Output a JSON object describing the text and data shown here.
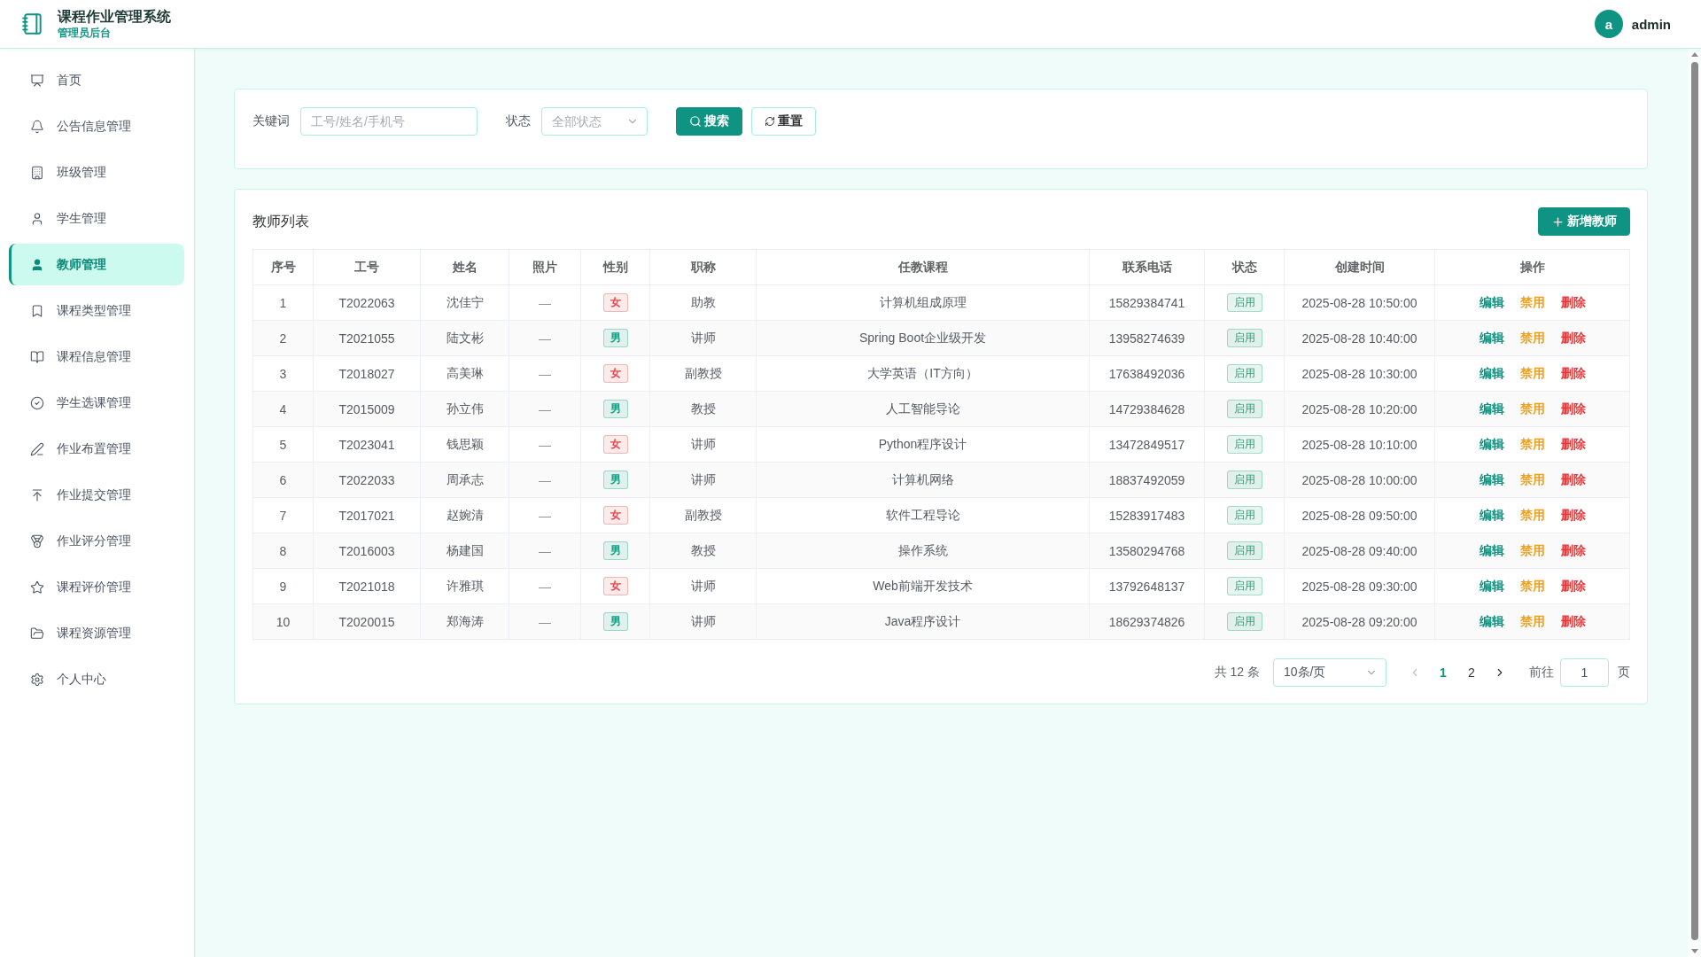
{
  "header": {
    "title": "课程作业管理系统",
    "subtitle": "管理员后台",
    "user": {
      "avatar": "a",
      "name": "admin"
    }
  },
  "sidebar": {
    "items": [
      {
        "label": "首页",
        "selected": false
      },
      {
        "label": "公告信息管理",
        "selected": false
      },
      {
        "label": "班级管理",
        "selected": false
      },
      {
        "label": "学生管理",
        "selected": false
      },
      {
        "label": "教师管理",
        "selected": true
      },
      {
        "label": "课程类型管理",
        "selected": false
      },
      {
        "label": "课程信息管理",
        "selected": false
      },
      {
        "label": "学生选课管理",
        "selected": false
      },
      {
        "label": "作业布置管理",
        "selected": false
      },
      {
        "label": "作业提交管理",
        "selected": false
      },
      {
        "label": "作业评分管理",
        "selected": false
      },
      {
        "label": "课程评价管理",
        "selected": false
      },
      {
        "label": "课程资源管理",
        "selected": false
      },
      {
        "label": "个人中心",
        "selected": false
      }
    ]
  },
  "search": {
    "keyword": {
      "label": "关键词",
      "placeholder": "工号/姓名/手机号"
    },
    "status": {
      "label": "状态",
      "placeholder": "全部状态"
    },
    "buttons": [
      {
        "label": "搜索",
        "kind": "primary"
      },
      {
        "label": "重置",
        "kind": "plain"
      }
    ]
  },
  "teacher_list": {
    "title": "教师列表",
    "add_button": "新增教师",
    "table": {
      "columns": [
        "序号",
        "工号",
        "姓名",
        "照片",
        "性别",
        "职称",
        "任教课程",
        "联系电话",
        "状态",
        "创建时间",
        "操作"
      ],
      "rows": [
        {
          "index": "1",
          "employee_id": "T2022063",
          "name": "沈佳宁",
          "photo": "—",
          "gender": {
            "text": "女",
            "color": "#e8484a"
          },
          "title": "助教",
          "course": "计算机组成原理",
          "phone": "15829384741",
          "status": "启用",
          "created": "2025-08-28 10:50:00",
          "actions": [
            {
              "label": "编辑",
              "kind": "edit"
            },
            {
              "label": "禁用",
              "kind": "disable"
            },
            {
              "label": "删除",
              "kind": "delete"
            }
          ]
        },
        {
          "index": "2",
          "employee_id": "T2021055",
          "name": "陆文彬",
          "photo": "—",
          "gender": {
            "text": "男",
            "color": "#12a084"
          },
          "title": "讲师",
          "course": "Spring Boot企业级开发",
          "phone": "13958274639",
          "status": "启用",
          "created": "2025-08-28 10:40:00",
          "actions": [
            {
              "label": "编辑",
              "kind": "edit"
            },
            {
              "label": "禁用",
              "kind": "disable"
            },
            {
              "label": "删除",
              "kind": "delete"
            }
          ]
        },
        {
          "index": "3",
          "employee_id": "T2018027",
          "name": "高美琳",
          "photo": "—",
          "gender": {
            "text": "女",
            "color": "#e8484a"
          },
          "title": "副教授",
          "course": "大学英语（IT方向）",
          "phone": "17638492036",
          "status": "启用",
          "created": "2025-08-28 10:30:00",
          "actions": [
            {
              "label": "编辑",
              "kind": "edit"
            },
            {
              "label": "禁用",
              "kind": "disable"
            },
            {
              "label": "删除",
              "kind": "delete"
            }
          ]
        },
        {
          "index": "4",
          "employee_id": "T2015009",
          "name": "孙立伟",
          "photo": "—",
          "gender": {
            "text": "男",
            "color": "#12a084"
          },
          "title": "教授",
          "course": "人工智能导论",
          "phone": "14729384628",
          "status": "启用",
          "created": "2025-08-28 10:20:00",
          "actions": [
            {
              "label": "编辑",
              "kind": "edit"
            },
            {
              "label": "禁用",
              "kind": "disable"
            },
            {
              "label": "删除",
              "kind": "delete"
            }
          ]
        },
        {
          "index": "5",
          "employee_id": "T2023041",
          "name": "钱思颖",
          "photo": "—",
          "gender": {
            "text": "女",
            "color": "#e8484a"
          },
          "title": "讲师",
          "course": "Python程序设计",
          "phone": "13472849517",
          "status": "启用",
          "created": "2025-08-28 10:10:00",
          "actions": [
            {
              "label": "编辑",
              "kind": "edit"
            },
            {
              "label": "禁用",
              "kind": "disable"
            },
            {
              "label": "删除",
              "kind": "delete"
            }
          ]
        },
        {
          "index": "6",
          "employee_id": "T2022033",
          "name": "周承志",
          "photo": "—",
          "gender": {
            "text": "男",
            "color": "#12a084"
          },
          "title": "讲师",
          "course": "计算机网络",
          "phone": "18837492059",
          "status": "启用",
          "created": "2025-08-28 10:00:00",
          "actions": [
            {
              "label": "编辑",
              "kind": "edit"
            },
            {
              "label": "禁用",
              "kind": "disable"
            },
            {
              "label": "删除",
              "kind": "delete"
            }
          ]
        },
        {
          "index": "7",
          "employee_id": "T2017021",
          "name": "赵婉清",
          "photo": "—",
          "gender": {
            "text": "女",
            "color": "#e8484a"
          },
          "title": "副教授",
          "course": "软件工程导论",
          "phone": "15283917483",
          "status": "启用",
          "created": "2025-08-28 09:50:00",
          "actions": [
            {
              "label": "编辑",
              "kind": "edit"
            },
            {
              "label": "禁用",
              "kind": "disable"
            },
            {
              "label": "删除",
              "kind": "delete"
            }
          ]
        },
        {
          "index": "8",
          "employee_id": "T2016003",
          "name": "杨建国",
          "photo": "—",
          "gender": {
            "text": "男",
            "color": "#12a084"
          },
          "title": "教授",
          "course": "操作系统",
          "phone": "13580294768",
          "status": "启用",
          "created": "2025-08-28 09:40:00",
          "actions": [
            {
              "label": "编辑",
              "kind": "edit"
            },
            {
              "label": "禁用",
              "kind": "disable"
            },
            {
              "label": "删除",
              "kind": "delete"
            }
          ]
        },
        {
          "index": "9",
          "employee_id": "T2021018",
          "name": "许雅琪",
          "photo": "—",
          "gender": {
            "text": "女",
            "color": "#e8484a"
          },
          "title": "讲师",
          "course": "Web前端开发技术",
          "phone": "13792648137",
          "status": "启用",
          "created": "2025-08-28 09:30:00",
          "actions": [
            {
              "label": "编辑",
              "kind": "edit"
            },
            {
              "label": "禁用",
              "kind": "disable"
            },
            {
              "label": "删除",
              "kind": "delete"
            }
          ]
        },
        {
          "index": "10",
          "employee_id": "T2020015",
          "name": "郑海涛",
          "photo": "—",
          "gender": {
            "text": "男",
            "color": "#12a084"
          },
          "title": "讲师",
          "course": "Java程序设计",
          "phone": "18629374826",
          "status": "启用",
          "created": "2025-08-28 09:20:00",
          "actions": [
            {
              "label": "编辑",
              "kind": "edit"
            },
            {
              "label": "禁用",
              "kind": "disable"
            },
            {
              "label": "删除",
              "kind": "delete"
            }
          ]
        }
      ]
    },
    "pagination": {
      "total": "共 12 条",
      "page_size": "10条/页",
      "prev": {
        "disabled": true
      },
      "pages": [
        {
          "label": "1",
          "selected": true
        },
        {
          "label": "2",
          "selected": false
        }
      ],
      "next": {
        "disabled": false
      },
      "goto_label": "前往",
      "goto_value": "1",
      "goto_suffix": "页"
    }
  }
}
